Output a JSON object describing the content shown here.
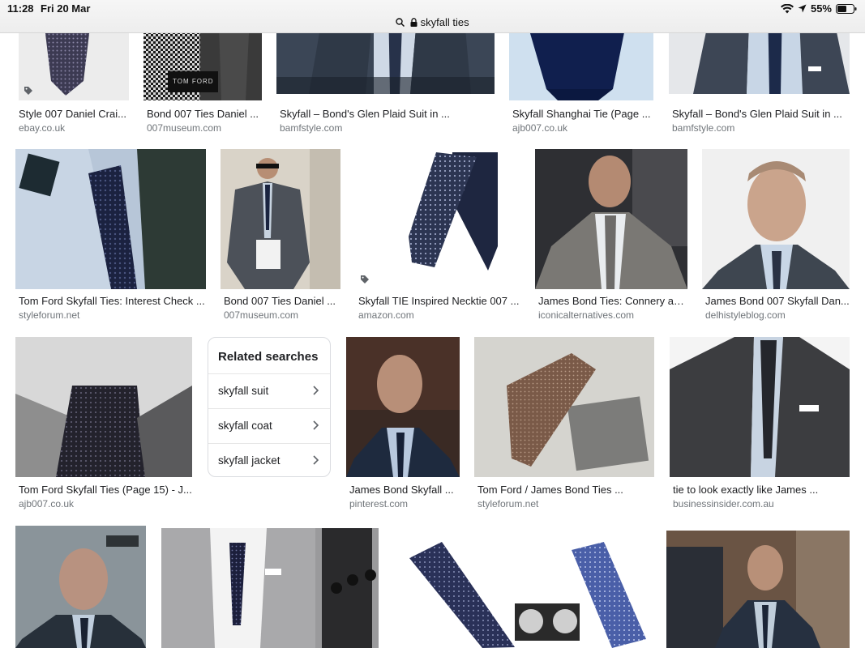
{
  "status_bar": {
    "time": "11:28",
    "date": "Fri 20 Mar",
    "battery": "55%"
  },
  "address_bar": {
    "query": "skyfall ties"
  },
  "row1": [
    {
      "caption": "Style 007 Daniel Crai...",
      "source": "ebay.co.uk"
    },
    {
      "caption": "Bond 007 Ties Daniel ...",
      "source": "007museum.com"
    },
    {
      "caption": "Skyfall – Bond's Glen Plaid Suit in ...",
      "source": "bamfstyle.com"
    },
    {
      "caption": "Skyfall Shanghai Tie (Page ...",
      "source": "ajb007.co.uk"
    },
    {
      "caption": "Skyfall – Bond's Glen Plaid Suit in ...",
      "source": "bamfstyle.com"
    }
  ],
  "row2": [
    {
      "caption": "Tom Ford Skyfall Ties: Interest Check ...",
      "source": "styleforum.net"
    },
    {
      "caption": "Bond 007 Ties Daniel ...",
      "source": "007museum.com"
    },
    {
      "caption": "Skyfall TIE Inspired Necktie 007 ...",
      "source": "amazon.com"
    },
    {
      "caption": "James Bond Ties: Connery an...",
      "source": "iconicalternatives.com"
    },
    {
      "caption": "James Bond 007 Skyfall Dan...",
      "source": "delhistyleblog.com"
    }
  ],
  "row3": [
    {
      "caption": "Tom Ford Skyfall Ties (Page 15) - J...",
      "source": "ajb007.co.uk"
    },
    {
      "caption": "James Bond Skyfall ...",
      "source": "pinterest.com"
    },
    {
      "caption": "Tom Ford / James Bond Ties ...",
      "source": "styleforum.net"
    },
    {
      "caption": "tie to look exactly like James ...",
      "source": "businessinsider.com.au"
    }
  ],
  "related": {
    "title": "Related searches",
    "items": [
      "skyfall suit",
      "skyfall coat",
      "skyfall jacket"
    ]
  },
  "image_labels": {
    "tom_ford_box": "TOM FORD"
  }
}
